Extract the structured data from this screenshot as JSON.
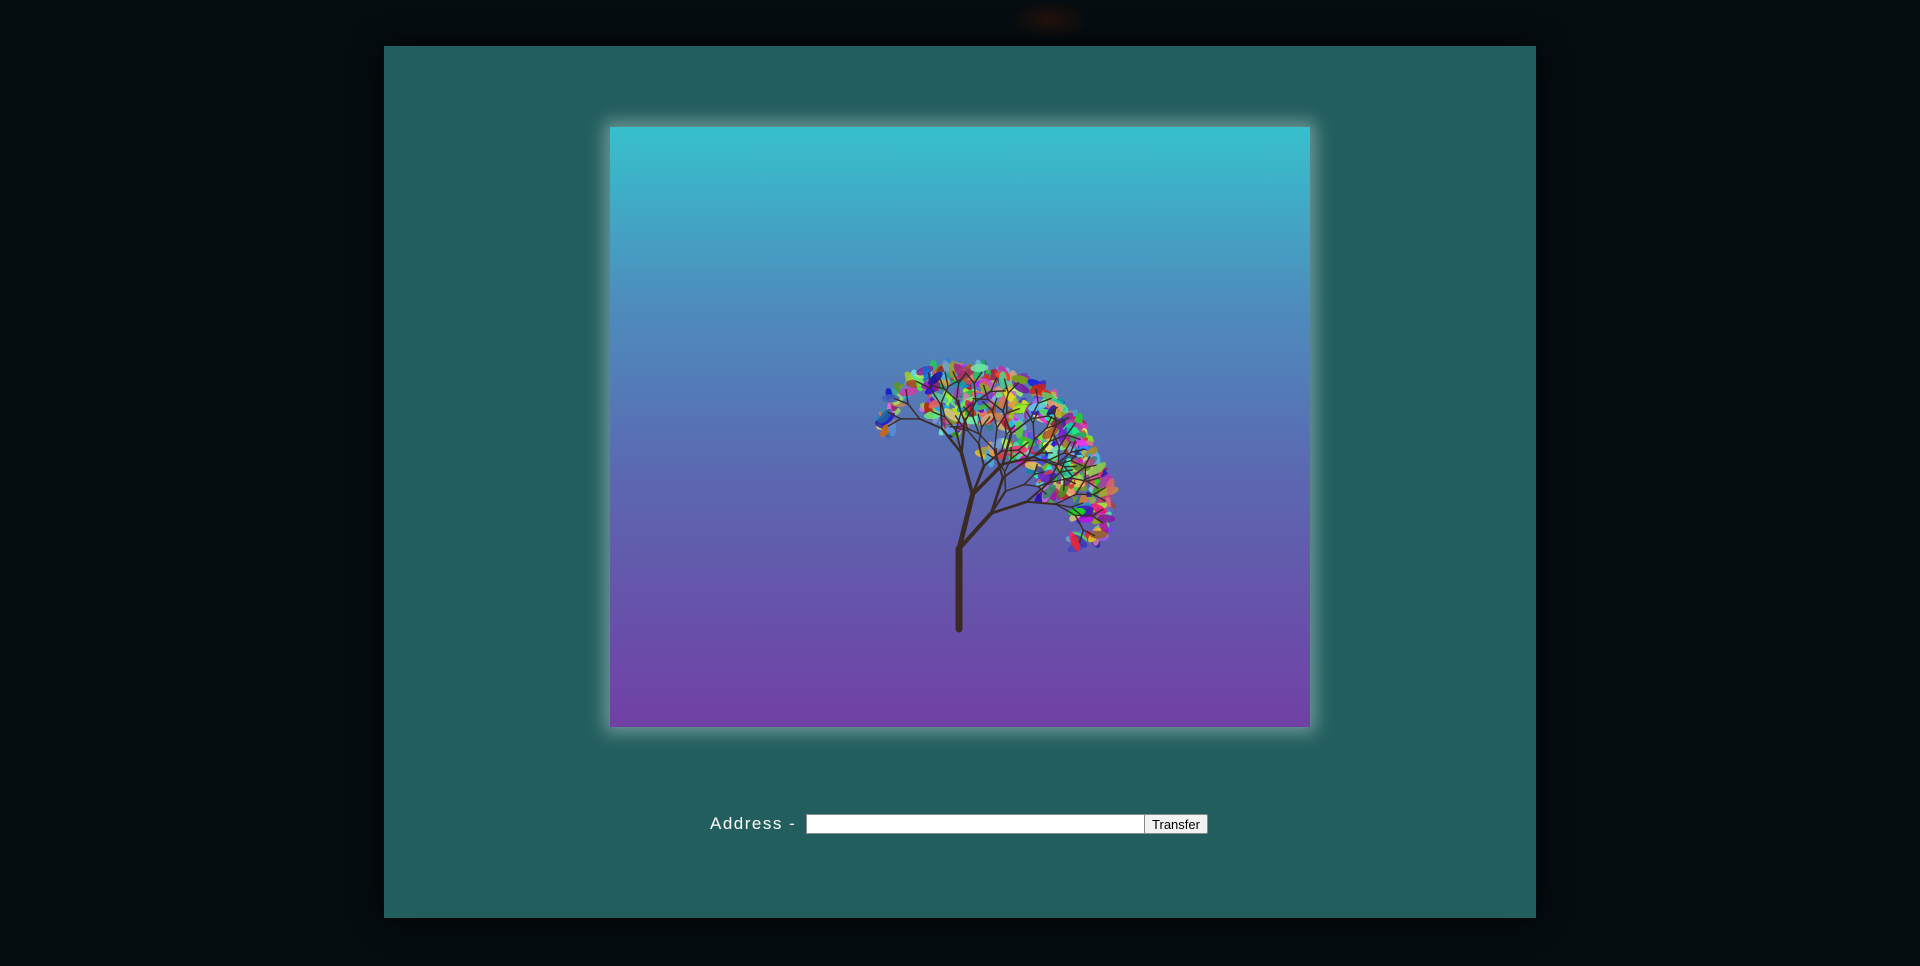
{
  "colors": {
    "page_background": "#050d10",
    "panel_background": "#235e5e",
    "sky_top": "#37c0cc",
    "sky_bottom": "#7140a5",
    "trunk": "#3a2a22"
  },
  "artwork": {
    "icon": "fractal-tree-with-colorful-leaves"
  },
  "transfer_form": {
    "address_label": "Address -",
    "address_value": "",
    "address_placeholder": "",
    "transfer_label": "Transfer"
  }
}
